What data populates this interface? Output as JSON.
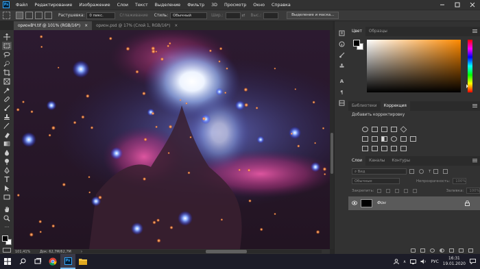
{
  "menubar": {
    "logo": "Ps",
    "items": [
      "Файл",
      "Редактирование",
      "Изображение",
      "Слои",
      "Текст",
      "Выделение",
      "Фильтр",
      "3D",
      "Просмотр",
      "Окно",
      "Справка"
    ],
    "controls": [
      "minimize",
      "maximize",
      "close"
    ]
  },
  "options": {
    "feather_label": "Растушевка:",
    "feather_value": "0 пикс.",
    "antialias_label": "Сглаживание",
    "style_label": "Стиль:",
    "style_value": "Обычный",
    "width_label": "Шир.:",
    "height_label": "Выс.:",
    "select_mask_button": "Выделение и маска..."
  },
  "tabs": [
    {
      "label": "орионВЧ.tif @ 101% (RGB/16*)",
      "close": "×",
      "active": true
    },
    {
      "label": "орион.psd @ 17% (Слой 1, RGB/16*)",
      "close": "×",
      "active": false
    }
  ],
  "status": {
    "zoom": "101,41%",
    "doc": "Док: 62,7M/62,7M",
    "arrow": "›"
  },
  "panels": {
    "color_tabs": [
      "Цвет",
      "Образцы"
    ],
    "adj_tabs": [
      "Библиотеки",
      "Коррекция"
    ],
    "adj_title": "Добавить корректировку",
    "layers_tabs": [
      "Слои",
      "Каналы",
      "Контуры"
    ],
    "kind_label": "Вид",
    "blend_mode": "Обычные",
    "opacity_label": "Непрозрачность:",
    "opacity_value": "100%",
    "lock_label": "Закрепить:",
    "fill_label": "Заливка:",
    "fill_value": "100%",
    "layer_name": "Фон"
  },
  "taskbar": {
    "lang": "РУС",
    "time": "16:31",
    "date": "19.01.2020"
  },
  "colors": {
    "accent": "#31a8ff",
    "active_tab": "#474747",
    "panel": "#323232"
  }
}
